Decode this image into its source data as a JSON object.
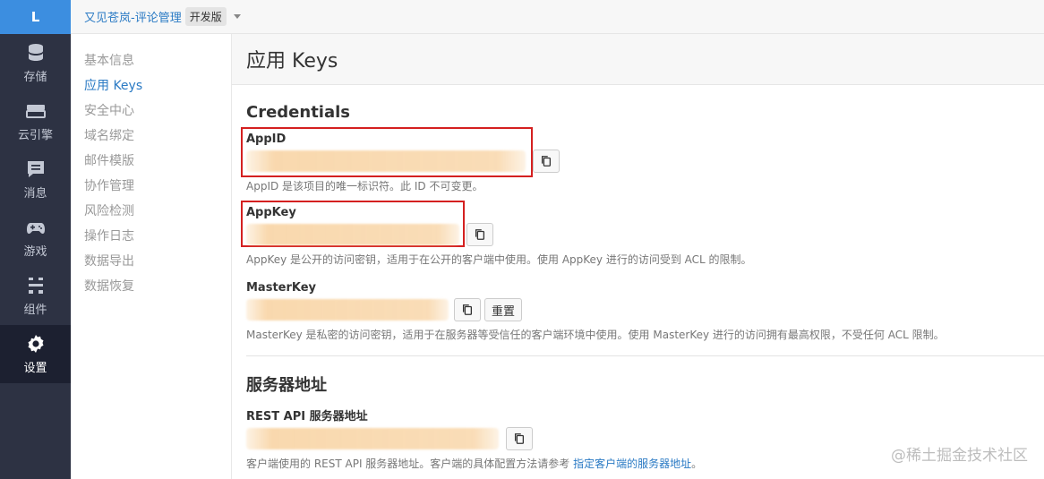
{
  "rail": {
    "logo": "L",
    "items": [
      {
        "label": "存储",
        "icon": "database-icon"
      },
      {
        "label": "云引擎",
        "icon": "server-icon"
      },
      {
        "label": "消息",
        "icon": "message-icon"
      },
      {
        "label": "游戏",
        "icon": "gamepad-icon"
      },
      {
        "label": "组件",
        "icon": "components-icon"
      },
      {
        "label": "设置",
        "icon": "gear-icon",
        "active": true
      }
    ]
  },
  "topbar": {
    "app_name": "又见苍岚-评论管理",
    "badge": "开发版"
  },
  "subnav": {
    "items": [
      "基本信息",
      "应用 Keys",
      "安全中心",
      "域名绑定",
      "邮件模版",
      "协作管理",
      "风险检测",
      "操作日志",
      "数据导出",
      "数据恢复"
    ],
    "active_index": 1
  },
  "page": {
    "title": "应用 Keys",
    "credentials": {
      "title": "Credentials",
      "appid": {
        "label": "AppID",
        "help": "AppID 是该项目的唯一标识符。此 ID 不可变更。"
      },
      "appkey": {
        "label": "AppKey",
        "help": "AppKey 是公开的访问密钥，适用于在公开的客户端中使用。使用 AppKey 进行的访问受到 ACL 的限制。"
      },
      "masterkey": {
        "label": "MasterKey",
        "reset_label": "重置",
        "help": "MasterKey 是私密的访问密钥，适用于在服务器等受信任的客户端环境中使用。使用 MasterKey 进行的访问拥有最高权限，不受任何 ACL 限制。"
      }
    },
    "server": {
      "title": "服务器地址",
      "rest": {
        "label": "REST API 服务器地址",
        "help_prefix": "客户端使用的 REST API 服务器地址。客户端的具体配置方法请参考 ",
        "help_link": "指定客户端的服务器地址",
        "help_suffix": "。"
      }
    }
  },
  "watermark": "@稀土掘金技术社区",
  "colors": {
    "accent": "#2a7ac4",
    "rail_bg": "#2d3243",
    "highlight": "#d42020"
  }
}
